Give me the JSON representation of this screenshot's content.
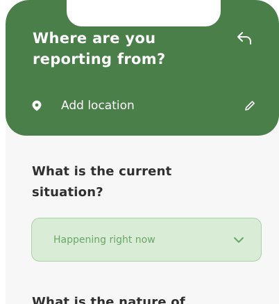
{
  "header": {
    "title": "Where are you reporting from?",
    "back_icon": "back-arrow-icon",
    "location": {
      "label": "Add location",
      "icon": "location-pin-icon",
      "edit_icon": "pencil-icon"
    },
    "background_color": "#4b7f4a"
  },
  "questions": [
    {
      "label": "What is the current situation?",
      "select": {
        "value": "Happening right now",
        "icon": "chevron-down-icon",
        "background_color": "#d9ecd6",
        "text_color": "#6aa667"
      }
    },
    {
      "label": "What is the nature of"
    }
  ]
}
